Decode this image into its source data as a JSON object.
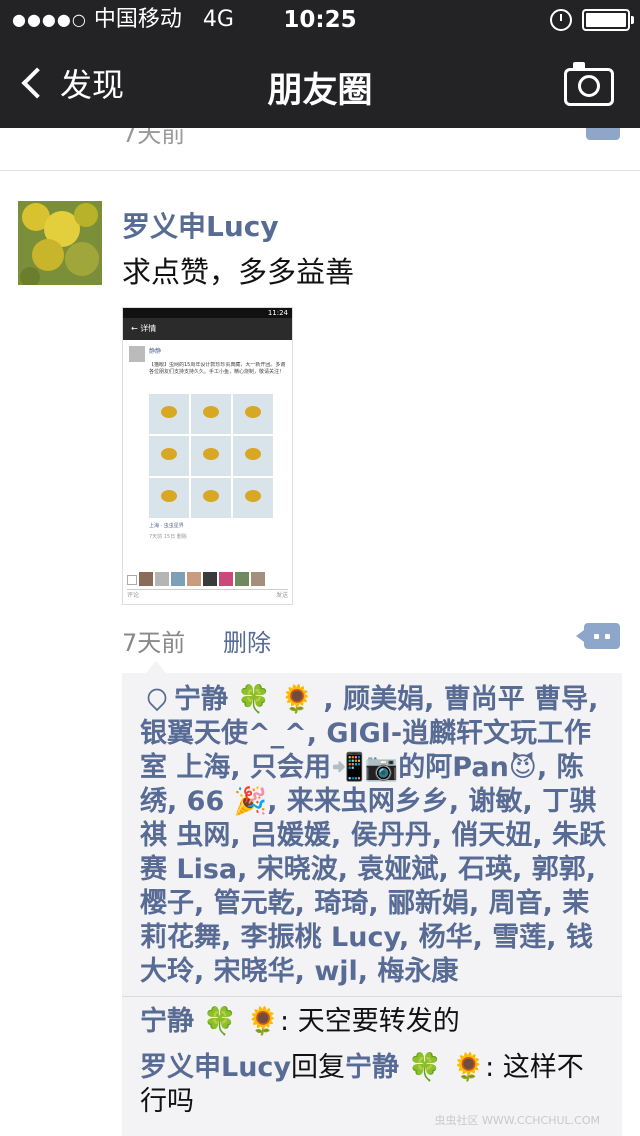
{
  "status_bar": {
    "carrier": "中国移动",
    "network": "4G",
    "time": "10:25"
  },
  "nav": {
    "back_label": "发现",
    "title": "朋友圈"
  },
  "prev_post": {
    "time": "7天前"
  },
  "post": {
    "author": "罗义申Lucy",
    "text": "求点赞，多多益善",
    "time": "7天前",
    "delete_label": "删除",
    "screenshot": {
      "status_time": "11:24",
      "nav_title": "详情",
      "user": "静静",
      "text": "【猫眼】虫网的15周年设计款珍珍贵典藏，大一新开团。多谢各位朋友们支持支持久久。手工小鱼，精心烧制，敬请关注！",
      "location": "上海 · 虫虫星界",
      "time_line": "7天前 15日  删除",
      "input_placeholder": "评论",
      "send_label": "发送"
    },
    "likes_text": "宁静 🍀 🌻 , 顾美娟, 曹尚平 曹导, 银翼天使^_^, GIGI-逍麟轩文玩工作室 上海, 只会用📲📷的阿Pan😈, 陈绣, 66 🎉, 来来虫网乡乡, 谢敏, 丁骐祺 虫网, 吕媛媛, 侯丹丹, 俏天妞, 朱跃赛 Lisa, 宋晓波, 袁娅斌, 石瑛, 郭郭, 樱子, 管元乾, 琦琦, 郦新娟, 周音, 茉莉花舞, 李振桃 Lucy, 杨华, 雪莲, 钱大玲, 宋晓华, wjl, 梅永康",
    "comments": [
      {
        "name": "宁静 🍀 🌻",
        "text": ": 天空要转发的"
      },
      {
        "name": "罗义申Lucy",
        "reply_word": "回复",
        "reply_to": "宁静 🍀 🌻",
        "text": ": 这样不行吗"
      }
    ]
  },
  "watermark": "虫虫社区 WWW.CCHCHUL.COM",
  "colors": {
    "link": "#576b95",
    "topbar": "#232326",
    "comment_bg": "#f3f3f5",
    "comment_icon": "#8ea6c9"
  }
}
